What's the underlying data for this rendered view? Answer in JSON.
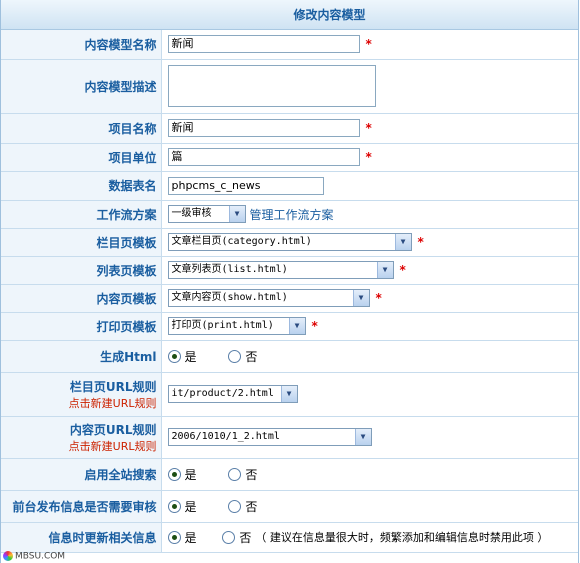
{
  "header": {
    "title": "修改内容模型"
  },
  "fields": {
    "name": {
      "label": "内容模型名称",
      "value": "新闻",
      "required": "*"
    },
    "desc": {
      "label": "内容模型描述"
    },
    "item_name": {
      "label": "项目名称",
      "value": "新闻",
      "required": "*"
    },
    "item_unit": {
      "label": "项目单位",
      "value": "篇",
      "required": "*"
    },
    "table_name": {
      "label": "数据表名",
      "value": "phpcms_c_news"
    },
    "workflow": {
      "label": "工作流方案",
      "selected": "一级审核",
      "link": "管理工作流方案"
    },
    "category_tpl": {
      "label": "栏目页模板",
      "selected": "文章栏目页(category.html)",
      "required": "*"
    },
    "list_tpl": {
      "label": "列表页模板",
      "selected": "文章列表页(list.html)",
      "required": "*"
    },
    "show_tpl": {
      "label": "内容页模板",
      "selected": "文章内容页(show.html)",
      "required": "*"
    },
    "print_tpl": {
      "label": "打印页模板",
      "selected": "打印页(print.html)",
      "required": "*"
    },
    "gen_html": {
      "label": "生成Html",
      "yes": "是",
      "no": "否",
      "value": "yes"
    },
    "cat_url": {
      "label": "栏目页URL规则",
      "sublabel": "点击新建URL规则",
      "selected": "it/product/2.html"
    },
    "content_url": {
      "label": "内容页URL规则",
      "sublabel": "点击新建URL规则",
      "selected": "2006/1010/1_2.html"
    },
    "site_search": {
      "label": "启用全站搜索",
      "yes": "是",
      "no": "否",
      "value": "yes"
    },
    "front_review": {
      "label": "前台发布信息是否需要审核",
      "yes": "是",
      "no": "否",
      "value": "yes"
    },
    "update_related": {
      "label": "信息时更新相关信息",
      "yes": "是",
      "no": "否",
      "value": "yes",
      "note": "（ 建议在信息量很大时，频繁添加和编辑信息时禁用此项 ）"
    }
  },
  "watermark": {
    "text": "MBSU.COM"
  }
}
